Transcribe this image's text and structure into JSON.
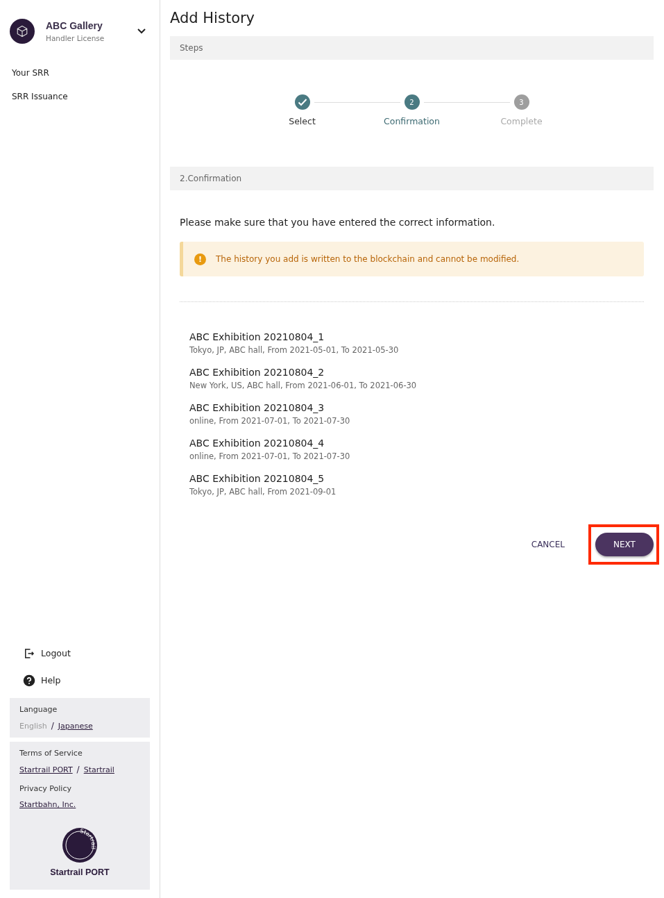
{
  "sidebar": {
    "account": {
      "name": "ABC Gallery",
      "role": "Handler License"
    },
    "nav": [
      {
        "label": "Your SRR"
      },
      {
        "label": "SRR Issuance"
      }
    ],
    "actions": [
      {
        "kind": "logout",
        "label": "Logout"
      },
      {
        "kind": "help",
        "label": "Help"
      }
    ],
    "language": {
      "title": "Language",
      "options": [
        {
          "label": "English",
          "selected": true
        },
        {
          "label": "Japanese",
          "selected": false
        }
      ],
      "separator": "/"
    },
    "legal": {
      "terms_title": "Terms of Service",
      "terms_links": [
        "Startrail PORT",
        "Startrail"
      ],
      "separator": "/",
      "privacy_title": "Privacy Policy",
      "privacy_link": "Startbahn, Inc."
    },
    "brand": {
      "logo_text": "Startrail",
      "name": "Startrail PORT"
    }
  },
  "page": {
    "title": "Add History",
    "steps_header": "Steps",
    "steps": [
      {
        "label": "Select",
        "completed": true,
        "selected": false
      },
      {
        "label": "Confirmation",
        "number": "2",
        "completed": false,
        "selected": true
      },
      {
        "label": "Complete",
        "number": "3",
        "completed": false,
        "selected": false
      }
    ],
    "section_header": "2.Confirmation",
    "instruction": "Please make sure that you have entered the correct information.",
    "warning": {
      "icon": "!",
      "text": "The history you add is written to the blockchain and cannot be modified."
    },
    "entries": [
      {
        "title": "ABC Exhibition 20210804_1",
        "detail": "Tokyo, JP, ABC hall, From 2021-05-01, To 2021-05-30"
      },
      {
        "title": "ABC Exhibition 20210804_2",
        "detail": "New York, US, ABC hall, From 2021-06-01, To 2021-06-30"
      },
      {
        "title": "ABC Exhibition 20210804_3",
        "detail": "online, From 2021-07-01, To 2021-07-30"
      },
      {
        "title": "ABC Exhibition 20210804_4",
        "detail": "online, From 2021-07-01, To 2021-07-30"
      },
      {
        "title": "ABC Exhibition 20210804_5",
        "detail": "Tokyo, JP, ABC hall, From 2021-09-01"
      }
    ],
    "buttons": {
      "cancel": "CANCEL",
      "next": "NEXT",
      "next_highlighted": true
    }
  }
}
